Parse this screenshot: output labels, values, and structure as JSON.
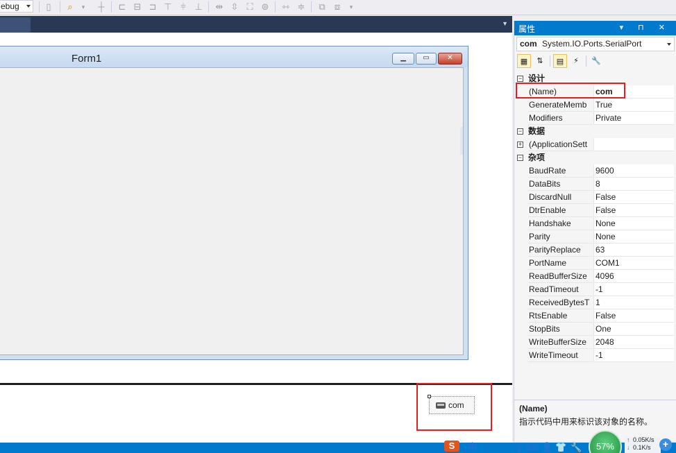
{
  "toolbar": {
    "config_combo": "ebug",
    "icons": [
      "toolbar-doc-icon",
      "find-icon",
      "align-lefts-icon",
      "align-centers-icon",
      "align-rights-icon",
      "align-tops-icon",
      "align-middles-icon",
      "align-bottoms-icon",
      "same-width-icon",
      "same-height-icon",
      "size-to-grid-icon",
      "same-size-icon",
      "horizontal-spacing-icon",
      "vertical-spacing-icon",
      "bring-to-front-icon",
      "send-to-back-icon"
    ]
  },
  "designer": {
    "form": {
      "title": "Form1",
      "minimize_glyph": "▁",
      "maximize_glyph": "▭",
      "close_glyph": "✕"
    },
    "tray": {
      "component_label": "com"
    }
  },
  "properties": {
    "title": "属性",
    "title_buttons": "▾ ⊓ ✕",
    "object_name": "com",
    "object_type": "System.IO.Ports.SerialPort",
    "toolbar": [
      "categorized-icon",
      "alphabetical-icon",
      "properties-icon",
      "events-icon",
      "property-pages-icon"
    ],
    "categories": [
      {
        "label": "设计",
        "toggle": "−",
        "rows": [
          {
            "name": "(Name)",
            "value": "com"
          },
          {
            "name": "GenerateMemb",
            "value": "True"
          },
          {
            "name": "Modifiers",
            "value": "Private"
          }
        ]
      },
      {
        "label": "数据",
        "toggle": "−",
        "rows": [
          {
            "name": "(ApplicationSett",
            "value": "",
            "expand": "+"
          }
        ]
      },
      {
        "label": "杂项",
        "toggle": "−",
        "rows": [
          {
            "name": "BaudRate",
            "value": "9600"
          },
          {
            "name": "DataBits",
            "value": "8"
          },
          {
            "name": "DiscardNull",
            "value": "False"
          },
          {
            "name": "DtrEnable",
            "value": "False"
          },
          {
            "name": "Handshake",
            "value": "None"
          },
          {
            "name": "Parity",
            "value": "None"
          },
          {
            "name": "ParityReplace",
            "value": "63"
          },
          {
            "name": "PortName",
            "value": "COM1"
          },
          {
            "name": "ReadBufferSize",
            "value": "4096"
          },
          {
            "name": "ReadTimeout",
            "value": "-1"
          },
          {
            "name": "ReceivedBytesT",
            "value": "1"
          },
          {
            "name": "RtsEnable",
            "value": "False"
          },
          {
            "name": "StopBits",
            "value": "One"
          },
          {
            "name": "WriteBufferSize",
            "value": "2048"
          },
          {
            "name": "WriteTimeout",
            "value": "-1"
          }
        ]
      }
    ],
    "description": {
      "title": "(Name)",
      "text": "指示代码中用来标识该对象的名称。"
    }
  },
  "taskbar": {
    "ime_label": "中",
    "sogou": "S",
    "gauge_percent": "57%",
    "upload": "0.05K/s",
    "download": "0.1K/s",
    "plus": "+"
  },
  "colors": {
    "accent": "#007acc",
    "highlight": "#e02020",
    "tab_bar": "#293955"
  }
}
